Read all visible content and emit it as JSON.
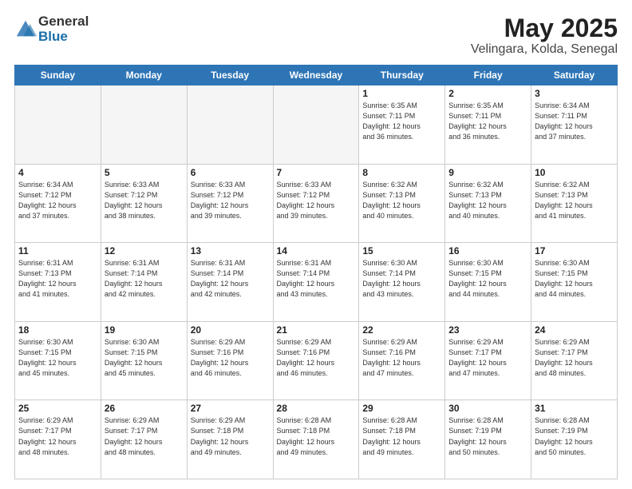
{
  "header": {
    "logo_general": "General",
    "logo_blue": "Blue",
    "month_year": "May 2025",
    "location": "Velingara, Kolda, Senegal"
  },
  "days_of_week": [
    "Sunday",
    "Monday",
    "Tuesday",
    "Wednesday",
    "Thursday",
    "Friday",
    "Saturday"
  ],
  "weeks": [
    [
      {
        "day": "",
        "info": ""
      },
      {
        "day": "",
        "info": ""
      },
      {
        "day": "",
        "info": ""
      },
      {
        "day": "",
        "info": ""
      },
      {
        "day": "1",
        "info": "Sunrise: 6:35 AM\nSunset: 7:11 PM\nDaylight: 12 hours\nand 36 minutes."
      },
      {
        "day": "2",
        "info": "Sunrise: 6:35 AM\nSunset: 7:11 PM\nDaylight: 12 hours\nand 36 minutes."
      },
      {
        "day": "3",
        "info": "Sunrise: 6:34 AM\nSunset: 7:11 PM\nDaylight: 12 hours\nand 37 minutes."
      }
    ],
    [
      {
        "day": "4",
        "info": "Sunrise: 6:34 AM\nSunset: 7:12 PM\nDaylight: 12 hours\nand 37 minutes."
      },
      {
        "day": "5",
        "info": "Sunrise: 6:33 AM\nSunset: 7:12 PM\nDaylight: 12 hours\nand 38 minutes."
      },
      {
        "day": "6",
        "info": "Sunrise: 6:33 AM\nSunset: 7:12 PM\nDaylight: 12 hours\nand 39 minutes."
      },
      {
        "day": "7",
        "info": "Sunrise: 6:33 AM\nSunset: 7:12 PM\nDaylight: 12 hours\nand 39 minutes."
      },
      {
        "day": "8",
        "info": "Sunrise: 6:32 AM\nSunset: 7:13 PM\nDaylight: 12 hours\nand 40 minutes."
      },
      {
        "day": "9",
        "info": "Sunrise: 6:32 AM\nSunset: 7:13 PM\nDaylight: 12 hours\nand 40 minutes."
      },
      {
        "day": "10",
        "info": "Sunrise: 6:32 AM\nSunset: 7:13 PM\nDaylight: 12 hours\nand 41 minutes."
      }
    ],
    [
      {
        "day": "11",
        "info": "Sunrise: 6:31 AM\nSunset: 7:13 PM\nDaylight: 12 hours\nand 41 minutes."
      },
      {
        "day": "12",
        "info": "Sunrise: 6:31 AM\nSunset: 7:14 PM\nDaylight: 12 hours\nand 42 minutes."
      },
      {
        "day": "13",
        "info": "Sunrise: 6:31 AM\nSunset: 7:14 PM\nDaylight: 12 hours\nand 42 minutes."
      },
      {
        "day": "14",
        "info": "Sunrise: 6:31 AM\nSunset: 7:14 PM\nDaylight: 12 hours\nand 43 minutes."
      },
      {
        "day": "15",
        "info": "Sunrise: 6:30 AM\nSunset: 7:14 PM\nDaylight: 12 hours\nand 43 minutes."
      },
      {
        "day": "16",
        "info": "Sunrise: 6:30 AM\nSunset: 7:15 PM\nDaylight: 12 hours\nand 44 minutes."
      },
      {
        "day": "17",
        "info": "Sunrise: 6:30 AM\nSunset: 7:15 PM\nDaylight: 12 hours\nand 44 minutes."
      }
    ],
    [
      {
        "day": "18",
        "info": "Sunrise: 6:30 AM\nSunset: 7:15 PM\nDaylight: 12 hours\nand 45 minutes."
      },
      {
        "day": "19",
        "info": "Sunrise: 6:30 AM\nSunset: 7:15 PM\nDaylight: 12 hours\nand 45 minutes."
      },
      {
        "day": "20",
        "info": "Sunrise: 6:29 AM\nSunset: 7:16 PM\nDaylight: 12 hours\nand 46 minutes."
      },
      {
        "day": "21",
        "info": "Sunrise: 6:29 AM\nSunset: 7:16 PM\nDaylight: 12 hours\nand 46 minutes."
      },
      {
        "day": "22",
        "info": "Sunrise: 6:29 AM\nSunset: 7:16 PM\nDaylight: 12 hours\nand 47 minutes."
      },
      {
        "day": "23",
        "info": "Sunrise: 6:29 AM\nSunset: 7:17 PM\nDaylight: 12 hours\nand 47 minutes."
      },
      {
        "day": "24",
        "info": "Sunrise: 6:29 AM\nSunset: 7:17 PM\nDaylight: 12 hours\nand 48 minutes."
      }
    ],
    [
      {
        "day": "25",
        "info": "Sunrise: 6:29 AM\nSunset: 7:17 PM\nDaylight: 12 hours\nand 48 minutes."
      },
      {
        "day": "26",
        "info": "Sunrise: 6:29 AM\nSunset: 7:17 PM\nDaylight: 12 hours\nand 48 minutes."
      },
      {
        "day": "27",
        "info": "Sunrise: 6:29 AM\nSunset: 7:18 PM\nDaylight: 12 hours\nand 49 minutes."
      },
      {
        "day": "28",
        "info": "Sunrise: 6:28 AM\nSunset: 7:18 PM\nDaylight: 12 hours\nand 49 minutes."
      },
      {
        "day": "29",
        "info": "Sunrise: 6:28 AM\nSunset: 7:18 PM\nDaylight: 12 hours\nand 49 minutes."
      },
      {
        "day": "30",
        "info": "Sunrise: 6:28 AM\nSunset: 7:19 PM\nDaylight: 12 hours\nand 50 minutes."
      },
      {
        "day": "31",
        "info": "Sunrise: 6:28 AM\nSunset: 7:19 PM\nDaylight: 12 hours\nand 50 minutes."
      }
    ]
  ]
}
